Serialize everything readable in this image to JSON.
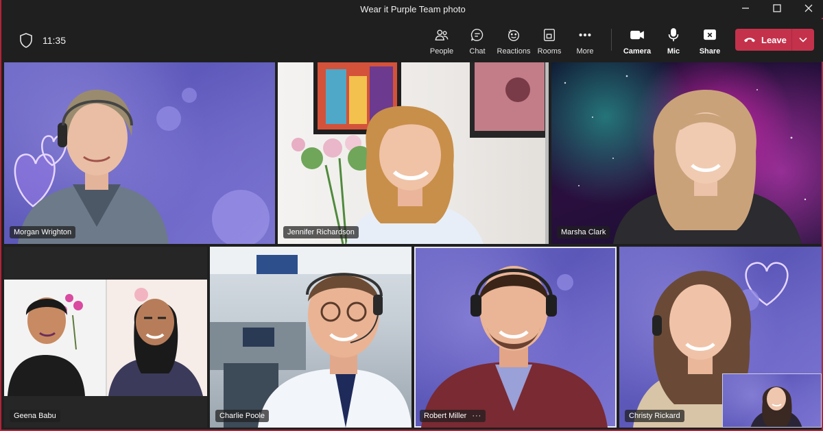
{
  "window": {
    "title": "Wear it Purple Team photo"
  },
  "toolbar": {
    "time": "11:35",
    "items": [
      {
        "label": "People",
        "icon": "people-icon"
      },
      {
        "label": "Chat",
        "icon": "chat-icon"
      },
      {
        "label": "Reactions",
        "icon": "reactions-icon"
      },
      {
        "label": "Rooms",
        "icon": "rooms-icon"
      },
      {
        "label": "More",
        "icon": "more-icon"
      },
      {
        "label": "Camera",
        "icon": "camera-icon"
      },
      {
        "label": "Mic",
        "icon": "mic-icon"
      },
      {
        "label": "Share",
        "icon": "share-icon"
      }
    ],
    "leave_label": "Leave"
  },
  "participants": [
    {
      "name": "Morgan Wrighton"
    },
    {
      "name": "Jennifer Richardson"
    },
    {
      "name": "Marsha Clark"
    },
    {
      "name": "Geena Babu"
    },
    {
      "name": "Charlie Poole"
    },
    {
      "name": "Robert Miller",
      "more": "···"
    },
    {
      "name": "Christy Rickard"
    }
  ],
  "colors": {
    "accent_leave": "#c4314b",
    "background": "#1f1f1f"
  }
}
